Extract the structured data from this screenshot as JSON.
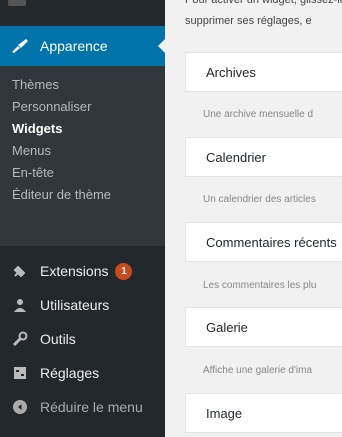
{
  "intro": {
    "line1": "Pour activer un widget, glissez-le",
    "line2": "supprimer ses réglages, e"
  },
  "sidebar": {
    "active": {
      "label": "Apparence",
      "icon": "paintbrush-icon"
    },
    "submenu": [
      {
        "label": "Thèmes"
      },
      {
        "label": "Personnaliser"
      },
      {
        "label": "Widgets"
      },
      {
        "label": "Menus"
      },
      {
        "label": "En-tête"
      },
      {
        "label": "Éditeur de thème"
      }
    ],
    "menu": [
      {
        "label": "Extensions",
        "icon": "plugin-icon",
        "badge": "1"
      },
      {
        "label": "Utilisateurs",
        "icon": "users-icon"
      },
      {
        "label": "Outils",
        "icon": "wrench-icon"
      },
      {
        "label": "Réglages",
        "icon": "settings-icon"
      },
      {
        "label": "Réduire le menu",
        "icon": "collapse-icon"
      }
    ]
  },
  "widgets": [
    {
      "title": "Archives",
      "desc": "Une archive mensuelle d"
    },
    {
      "title": "Calendrier",
      "desc": "Un calendrier des articles"
    },
    {
      "title": "Commentaires récents",
      "desc": "Les commentaires les plu"
    },
    {
      "title": "Galerie",
      "desc": "Affiche une galerie d'ima"
    },
    {
      "title": "Image",
      "desc": ""
    }
  ],
  "colors": {
    "sidebar": "#23282d",
    "active": "#0073aa",
    "badge": "#ca4a1f",
    "background": "#f1f1f1"
  }
}
